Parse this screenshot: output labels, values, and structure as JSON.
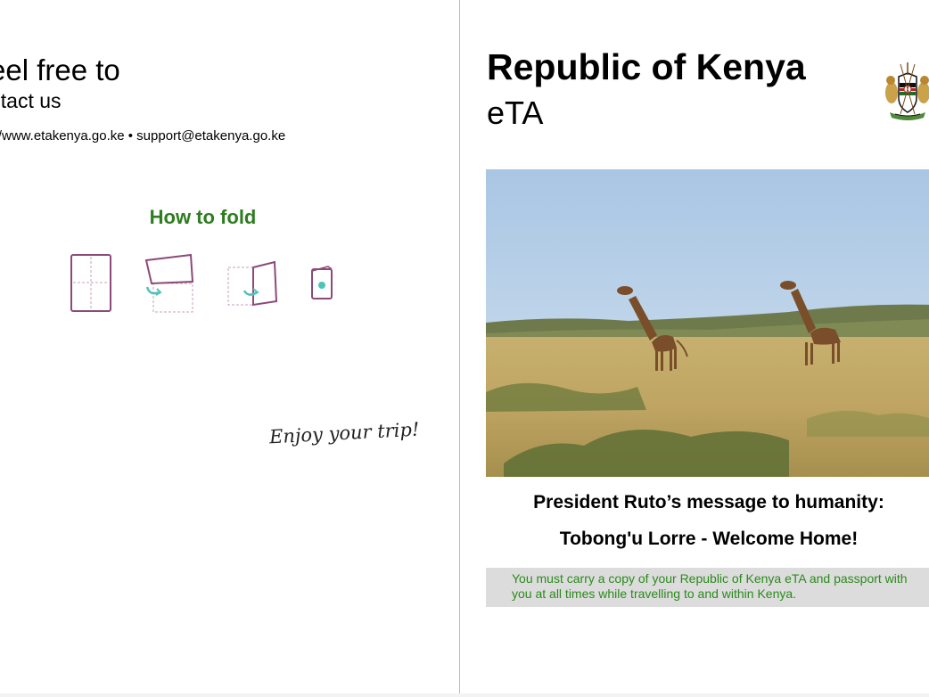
{
  "left_page": {
    "contact_heading": "eel free to",
    "contact_sub": "ntact us",
    "contact_line": "s://www.etakenya.go.ke • support@etakenya.go.ke",
    "fold_title": "How to fold",
    "enjoy_text": "Enjoy your trip!"
  },
  "right_page": {
    "title": "Republic of Kenya",
    "subtitle": "eTA",
    "message_line1": "President Ruto’s message to humanity:",
    "message_line2": "Tobong'u Lorre - Welcome Home!",
    "notice_text": "You must carry a copy of your Republic of Kenya eTA and passport with you at all times while travelling to and within Kenya."
  },
  "colors": {
    "accent_green": "#2e7d1f",
    "fold_icon": "#8b4a78",
    "divider": "#d9a6d0",
    "notice_bg": "#dcdcdc"
  },
  "icons": [
    "fold-step-1-icon",
    "fold-step-2-icon",
    "fold-step-3-icon",
    "fold-step-4-icon",
    "coat-of-arms-icon"
  ]
}
